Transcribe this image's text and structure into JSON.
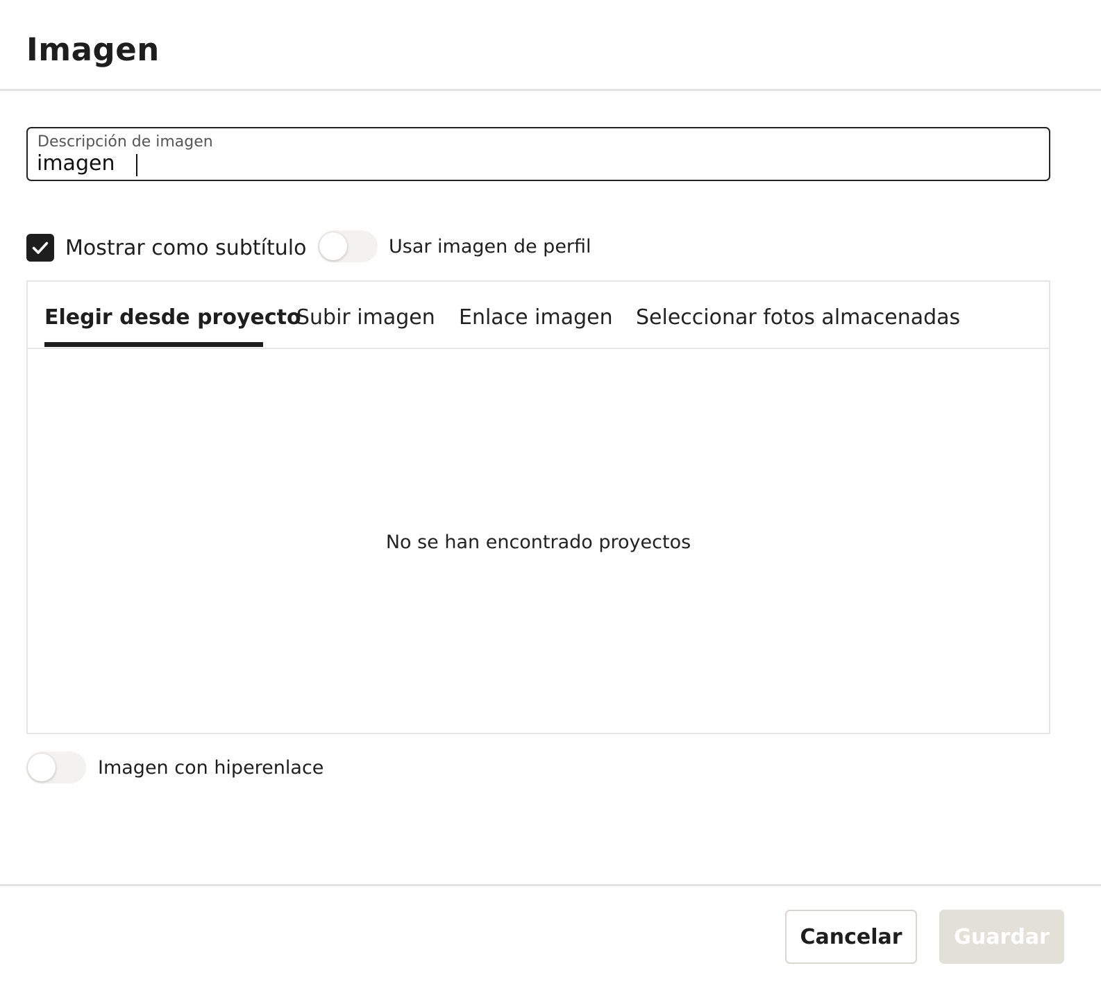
{
  "dialog": {
    "title": "Imagen"
  },
  "description_field": {
    "label": "Descripción de imagen",
    "value": "imagen"
  },
  "options": {
    "show_caption": {
      "label": "Mostrar como subtítulo",
      "checked": true
    },
    "use_profile_image": {
      "label": "Usar imagen de perfil",
      "on": false
    },
    "image_hyperlink": {
      "label": "Imagen con hiperenlace",
      "on": false
    }
  },
  "tabs": [
    {
      "label": "Elegir desde proyecto",
      "active": true
    },
    {
      "label": "Subir imagen",
      "active": false
    },
    {
      "label": "Enlace imagen",
      "active": false
    },
    {
      "label": "Seleccionar fotos almacenadas",
      "active": false
    }
  ],
  "panel": {
    "empty_message": "No se han encontrado proyectos"
  },
  "footer": {
    "cancel_label": "Cancelar",
    "save_label": "Guardar"
  },
  "colors": {
    "primary_dark": "#1e1e1e",
    "disabled_button": "#e3e0d8",
    "divider": "#e3e3e3"
  },
  "icons": {
    "checkbox": "check-icon"
  }
}
